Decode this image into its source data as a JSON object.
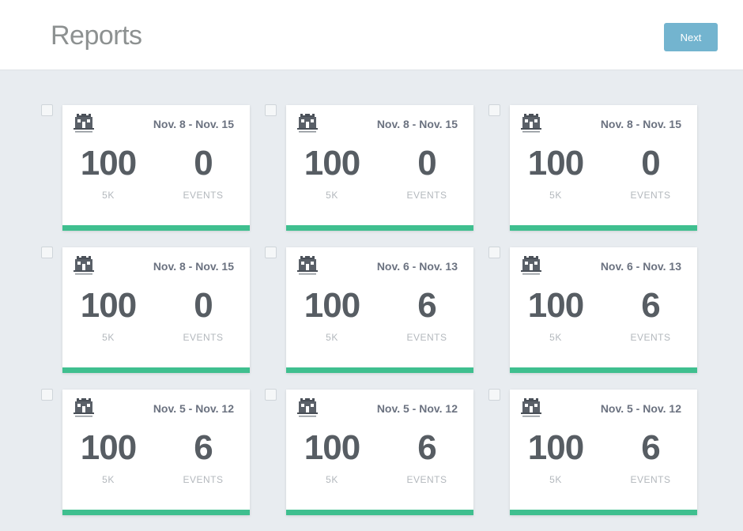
{
  "header": {
    "title": "Reports",
    "action_label": "Next"
  },
  "cards": [
    {
      "date_range": "Nov. 8 - Nov. 15",
      "primary_value": "100",
      "primary_label": "5K",
      "secondary_value": "0",
      "secondary_label": "EVENTS",
      "icon": "castle-icon"
    },
    {
      "date_range": "Nov. 8 - Nov. 15",
      "primary_value": "100",
      "primary_label": "5K",
      "secondary_value": "0",
      "secondary_label": "EVENTS",
      "icon": "castle-icon"
    },
    {
      "date_range": "Nov. 8 - Nov. 15",
      "primary_value": "100",
      "primary_label": "5K",
      "secondary_value": "0",
      "secondary_label": "EVENTS",
      "icon": "castle-icon"
    },
    {
      "date_range": "Nov. 8 - Nov. 15",
      "primary_value": "100",
      "primary_label": "5K",
      "secondary_value": "0",
      "secondary_label": "EVENTS",
      "icon": "castle-icon"
    },
    {
      "date_range": "Nov. 6 - Nov. 13",
      "primary_value": "100",
      "primary_label": "5K",
      "secondary_value": "6",
      "secondary_label": "EVENTS",
      "icon": "castle-icon"
    },
    {
      "date_range": "Nov. 6 - Nov. 13",
      "primary_value": "100",
      "primary_label": "5K",
      "secondary_value": "6",
      "secondary_label": "EVENTS",
      "icon": "castle-icon"
    },
    {
      "date_range": "Nov. 5 - Nov. 12",
      "primary_value": "100",
      "primary_label": "5K",
      "secondary_value": "6",
      "secondary_label": "EVENTS",
      "icon": "castle-icon"
    },
    {
      "date_range": "Nov. 5 - Nov. 12",
      "primary_value": "100",
      "primary_label": "5K",
      "secondary_value": "6",
      "secondary_label": "EVENTS",
      "icon": "castle-icon"
    },
    {
      "date_range": "Nov. 5 - Nov. 12",
      "primary_value": "100",
      "primary_label": "5K",
      "secondary_value": "6",
      "secondary_label": "EVENTS",
      "icon": "castle-icon"
    }
  ],
  "colors": {
    "accent_bar": "#3fbf8f",
    "button": "#73b4cf",
    "background": "#e8ecf0"
  }
}
